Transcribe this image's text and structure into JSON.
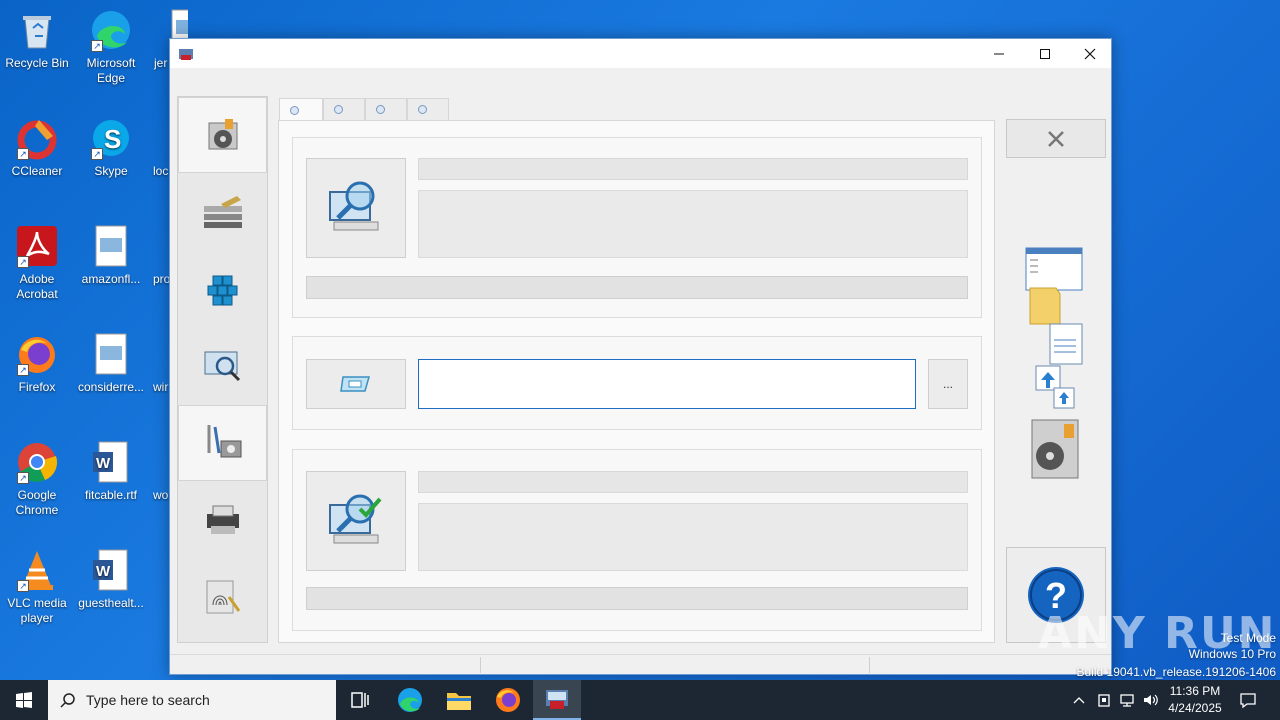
{
  "desktop": {
    "icons": [
      {
        "label": "Recycle Bin"
      },
      {
        "label": "Microsoft Edge"
      },
      {
        "label": "jer"
      },
      {
        "label": "CCleaner"
      },
      {
        "label": "Skype"
      },
      {
        "label": "loc"
      },
      {
        "label": "Adobe Acrobat"
      },
      {
        "label": "amazonfl..."
      },
      {
        "label": "pro"
      },
      {
        "label": "Firefox"
      },
      {
        "label": "considerre..."
      },
      {
        "label": "wir"
      },
      {
        "label": "Google Chrome"
      },
      {
        "label": "fitcable.rtf"
      },
      {
        "label": "wo"
      },
      {
        "label": "VLC media player"
      },
      {
        "label": "guesthealt..."
      }
    ]
  },
  "window": {
    "browse_label": "...",
    "path_value": ""
  },
  "watermark": {
    "line1": "Test Mode",
    "line2": "Windows 10 Pro",
    "line3": "Build 19041.vb_release.191206-1406",
    "brand": "ANY RUN"
  },
  "taskbar": {
    "search_placeholder": "Type here to search",
    "time": "11:36 PM",
    "date": "4/24/2025"
  },
  "colors": {
    "desktop_bg": "#0f5bc4",
    "taskbar_bg": "#1c2733",
    "input_border": "#1e6fc2",
    "help_blue": "#1565c0"
  }
}
